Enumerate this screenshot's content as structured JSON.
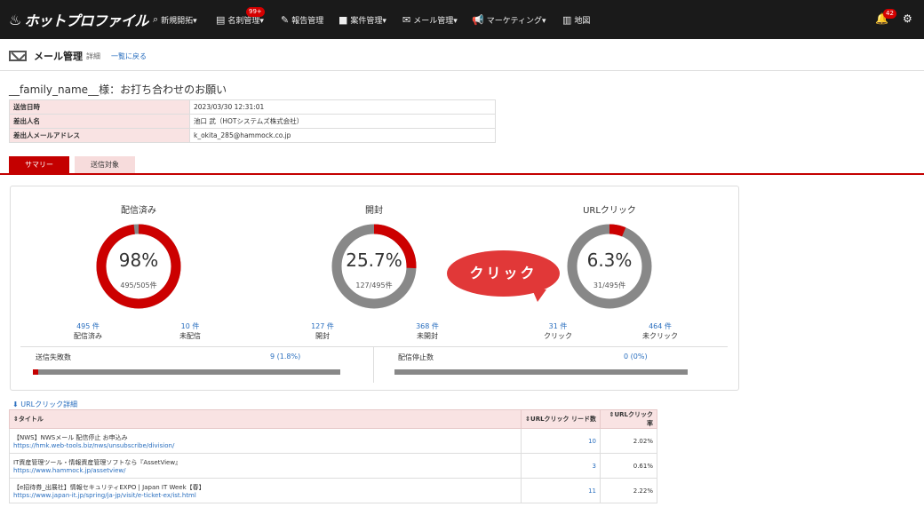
{
  "topbar": {
    "logo": "ホットプロファイル",
    "nav": [
      {
        "label": "新規開拓▾",
        "icon": "search-doc-icon"
      },
      {
        "label": "名刺管理▾",
        "icon": "card-icon",
        "badge": "99+"
      },
      {
        "label": "報告管理",
        "icon": "edit-icon"
      },
      {
        "label": "案件管理▾",
        "icon": "briefcase-icon"
      },
      {
        "label": "メール管理▾",
        "icon": "mail-icon"
      },
      {
        "label": "マーケティング▾",
        "icon": "megaphone-icon"
      },
      {
        "label": "地図",
        "icon": "map-icon"
      }
    ],
    "notifications": "42"
  },
  "page": {
    "title": "メール管理",
    "detail": "詳細",
    "back_link": "一覧に戻る",
    "subject": "__family_name__様：お打ち合わせのお願い"
  },
  "info": [
    {
      "key": "送信日時",
      "value": "2023/03/30 12:31:01"
    },
    {
      "key": "差出人名",
      "value": "池口 武（HOTシステムズ株式会社）"
    },
    {
      "key": "差出人メールアドレス",
      "value": "k_okita_285@hammock.co.jp"
    }
  ],
  "tabs": {
    "summary": "サマリー",
    "targets": "送信対象"
  },
  "summary": {
    "donuts": [
      {
        "title": "配信済み",
        "percent": "98%",
        "sub": "495/505件",
        "fill": 0.98
      },
      {
        "title": "開封",
        "percent": "25.7%",
        "sub": "127/495件",
        "fill": 0.257
      },
      {
        "title": "URLクリック",
        "percent": "6.3%",
        "sub": "31/495件",
        "fill": 0.063
      }
    ],
    "stats": [
      {
        "n": "495 件",
        "label": "配信済み"
      },
      {
        "n": "10 件",
        "label": "未配信"
      },
      {
        "n": "127 件",
        "label": "開封"
      },
      {
        "n": "368 件",
        "label": "未開封"
      },
      {
        "n": "31 件",
        "label": "クリック"
      },
      {
        "n": "464 件",
        "label": "未クリック"
      }
    ],
    "callout": "クリック",
    "failed_label": "送信失敗数",
    "failed_value": "9 (1.8%)",
    "failed_fill": 0.018,
    "stopped_label": "配信停止数",
    "stopped_value": "0 (0%)",
    "stopped_fill": 0
  },
  "url_clicks": {
    "heading": "URLクリック詳細",
    "col_title": "タイトル",
    "col_count": "URLクリック リード数",
    "col_rate": "URLクリック率",
    "rows": [
      {
        "title": "【NWS】NWSメール 配信停止 お申込み",
        "url": "https://hmk.web-tools.biz/nws/unsubscribe/division/",
        "count": "10",
        "rate": "2.02%"
      },
      {
        "title": "IT資産管理ツール・情報資産管理ソフトなら『AssetView』",
        "url": "https://www.hammock.jp/assetview/",
        "count": "3",
        "rate": "0.61%"
      },
      {
        "title": "【e招待券_出展社】情報セキュリティEXPO | Japan IT Week【春】",
        "url": "https://www.japan-it.jp/spring/ja-jp/visit/e-ticket-ex/ist.html",
        "count": "11",
        "rate": "2.22%"
      }
    ]
  }
}
